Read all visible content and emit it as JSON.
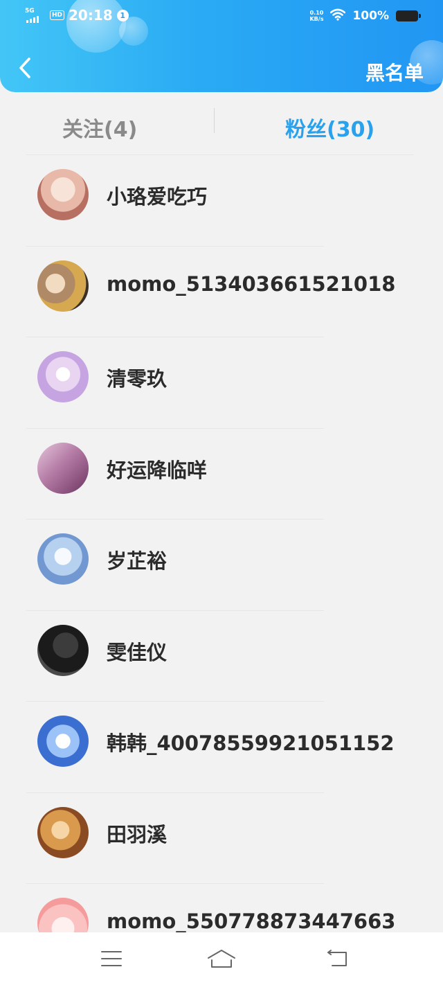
{
  "status_bar": {
    "network": "5G",
    "hd_label": "HD",
    "time": "20:18",
    "notification_count": "1",
    "net_speed_value": "0.10",
    "net_speed_unit": "KB/s",
    "battery_percent": "100%"
  },
  "header": {
    "back_icon": "chevron-left-icon",
    "blacklist_label": "黑名单"
  },
  "tabs": {
    "following_label": "关注(4)",
    "fans_label": "粉丝(30)",
    "active": "fans",
    "active_color": "#2aa1ec",
    "inactive_color": "#8a8a8a"
  },
  "fans": [
    {
      "name": "小珞爱吃巧"
    },
    {
      "name": "momo_513403661521018"
    },
    {
      "name": "清零玖"
    },
    {
      "name": "好运降临咩"
    },
    {
      "name": "岁芷裕"
    },
    {
      "name": "雯佳仪"
    },
    {
      "name": "韩韩_40078559921051152"
    },
    {
      "name": "田羽溪"
    },
    {
      "name": "momo_550778873447663"
    }
  ],
  "nav_bar": {
    "menu_icon": "menu-icon",
    "home_icon": "home-icon",
    "back_icon": "back-icon"
  },
  "colors": {
    "header_gradient_start": "#43c6f6",
    "header_gradient_end": "#2196f3",
    "background": "#f2f2f2"
  }
}
